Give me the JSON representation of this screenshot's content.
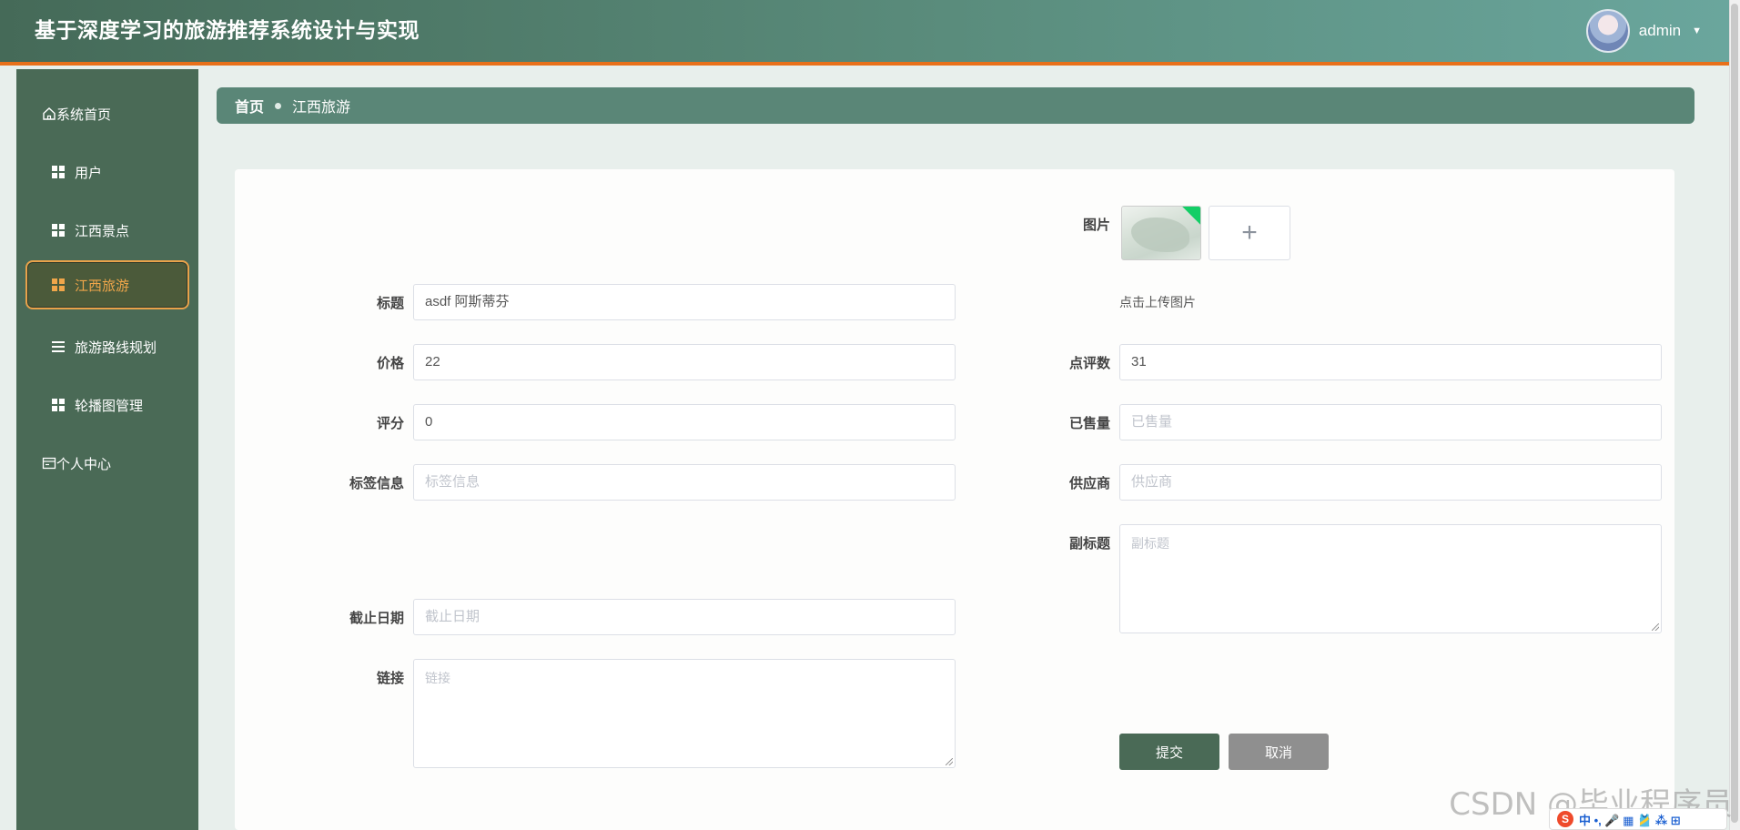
{
  "app": {
    "title": "基于深度学习的旅游推荐系统设计与实现"
  },
  "user": {
    "name": "admin"
  },
  "sidebar": {
    "items": [
      {
        "label": "系统首页",
        "icon": "home-icon"
      },
      {
        "label": "用户",
        "icon": "grid-icon"
      },
      {
        "label": "江西景点",
        "icon": "grid-icon"
      },
      {
        "label": "江西旅游",
        "icon": "grid-icon",
        "active": true
      },
      {
        "label": "旅游路线规划",
        "icon": "list-icon"
      },
      {
        "label": "轮播图管理",
        "icon": "grid-icon"
      },
      {
        "label": "个人中心",
        "icon": "profile-card-icon"
      }
    ]
  },
  "breadcrumb": {
    "home": "首页",
    "current": "江西旅游"
  },
  "form": {
    "image_label": "图片",
    "upload_tip": "点击上传图片",
    "title_label": "标题",
    "title_value": "asdf 阿斯蒂芬",
    "price_label": "价格",
    "price_value": "22",
    "rating_label": "评分",
    "rating_value": "0",
    "tags_label": "标签信息",
    "tags_placeholder": "标签信息",
    "reviews_label": "点评数",
    "reviews_value": "31",
    "sold_label": "已售量",
    "sold_placeholder": "已售量",
    "supplier_label": "供应商",
    "supplier_placeholder": "供应商",
    "subtitle_label": "副标题",
    "subtitle_placeholder": "副标题",
    "deadline_label": "截止日期",
    "deadline_placeholder": "截止日期",
    "link_label": "链接",
    "link_placeholder": "链接",
    "submit_label": "提交",
    "cancel_label": "取消"
  },
  "watermark": "CSDN @毕业程序员",
  "ime": {
    "badge": "S",
    "text": "中 •, 🎤 ▦ 🎽 ⁂ ⊞"
  },
  "colors": {
    "header_start": "#456a58",
    "header_end": "#6aa69d",
    "accent_orange": "#e8701a",
    "sidebar_bg": "#4a6a56",
    "active_text": "#f0a64a",
    "submit_bg": "#4a6a56",
    "cancel_bg": "#8f8f8f"
  }
}
